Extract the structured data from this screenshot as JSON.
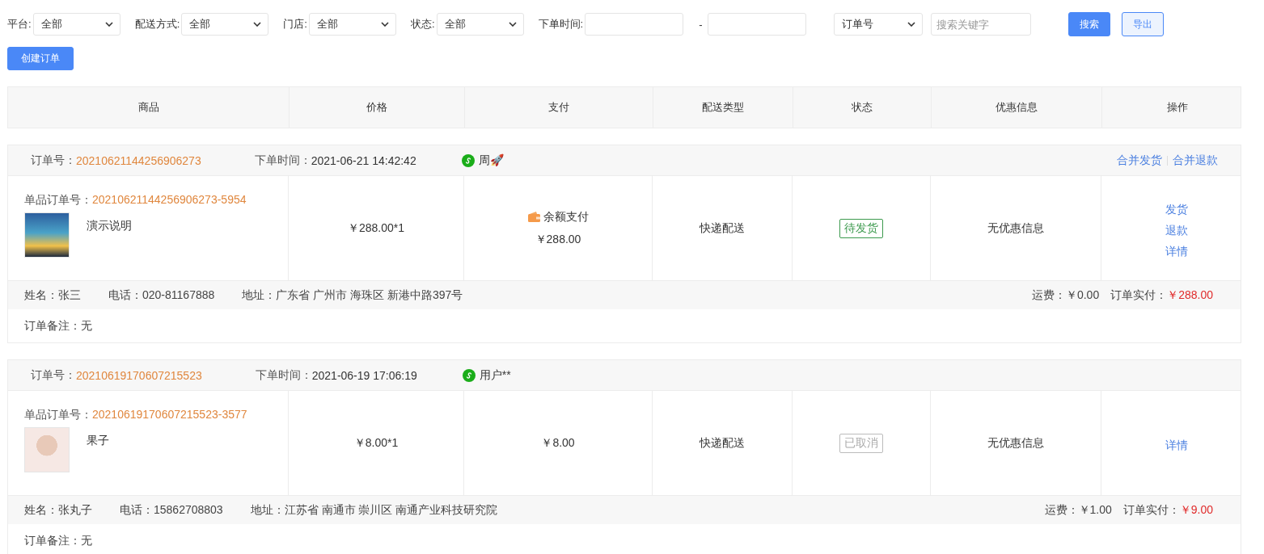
{
  "filters": [
    {
      "label": "平台:",
      "value": "全部"
    },
    {
      "label": "配送方式:",
      "value": "全部"
    },
    {
      "label": "门店:",
      "value": "全部"
    },
    {
      "label": "状态:",
      "value": "全部"
    }
  ],
  "date_range": {
    "label": "下单时间:",
    "separator": "-"
  },
  "search": {
    "type": "订单号",
    "placeholder": "搜索关键字"
  },
  "buttons": [
    {
      "label": "搜索",
      "kind": "primary"
    },
    {
      "label": "导出",
      "kind": "outline"
    }
  ],
  "create_button": "创建订单",
  "table": {
    "columns": [
      "商品",
      "价格",
      "支付",
      "配送类型",
      "状态",
      "优惠信息",
      "操作"
    ]
  },
  "orders": [
    {
      "order_no_label": "订单号：",
      "order_no": "20210621144256906273",
      "time_label": "下单时间：",
      "time": "2021-06-21 14:42:42",
      "user": "周🚀",
      "header_actions": [
        "合并发货",
        "合并退款"
      ],
      "item_no_label": "单品订单号：",
      "item_no": "20210621144256906273-5954",
      "product": "演示说明",
      "price": "￥288.00*1",
      "payment_method": "余额支付",
      "payment_amount": "￥288.00",
      "delivery": "快递配送",
      "status": {
        "label": "待发货",
        "kind": "pending"
      },
      "discount": "无优惠信息",
      "actions": [
        "发货",
        "退款",
        "详情"
      ],
      "name": "姓名：张三",
      "phone": "电话：020-81167888",
      "address": "地址：广东省 广州市 海珠区 新港中路397号",
      "freight_label": "运费：",
      "freight": "￥0.00",
      "paid_label": "订单实付：",
      "paid": "￥288.00",
      "remark": "订单备注：无"
    },
    {
      "order_no_label": "订单号：",
      "order_no": "20210619170607215523",
      "time_label": "下单时间：",
      "time": "2021-06-19 17:06:19",
      "user": "用户**",
      "item_no_label": "单品订单号：",
      "item_no": "20210619170607215523-3577",
      "product": "果子",
      "price": "￥8.00*1",
      "payment_amount": "￥8.00",
      "delivery": "快递配送",
      "status": {
        "label": "已取消",
        "kind": "cancelled"
      },
      "discount": "无优惠信息",
      "actions": [
        "详情"
      ],
      "name": "姓名：张丸子",
      "phone": "电话：15862708803",
      "address": "地址：江苏省 南通市 崇川区 南通产业科技研究院",
      "freight_label": "运费：",
      "freight": "￥1.00",
      "paid_label": "订单实付：",
      "paid": "￥9.00",
      "remark": "订单备注：无"
    }
  ]
}
